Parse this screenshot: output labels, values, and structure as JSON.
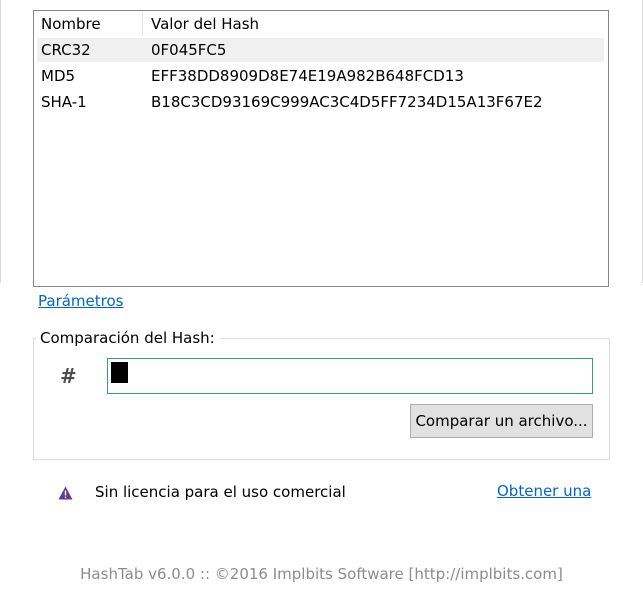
{
  "hash_list": {
    "columns": {
      "name": "Nombre",
      "value": "Valor del Hash"
    },
    "rows": [
      {
        "name": "CRC32",
        "value": "0F045FC5",
        "selected": true
      },
      {
        "name": "MD5",
        "value": "EFF38DD8909D8E74E19A982B648FCD13",
        "selected": false
      },
      {
        "name": "SHA-1",
        "value": "B18C3CD93169C999AC3C4D5FF7234D15A13F67E2",
        "selected": false
      }
    ]
  },
  "settings_link": "Parámetros",
  "compare": {
    "legend": "Comparación del Hash:",
    "hash_icon": "#",
    "input_value": "",
    "button_label": "Comparar un archivo..."
  },
  "license": {
    "icon": "warning-icon",
    "icon_color": "#5a3f8c",
    "text": "Sin licencia para el uso comercial",
    "link": "Obtener una"
  },
  "footer": "HashTab v6.0.0 :: ©2016 Implbits Software [http://implbits.com]",
  "colors": {
    "link": "#0066cc",
    "input_border": "#3c8fb6",
    "selected_row": "#f0f0f0"
  }
}
